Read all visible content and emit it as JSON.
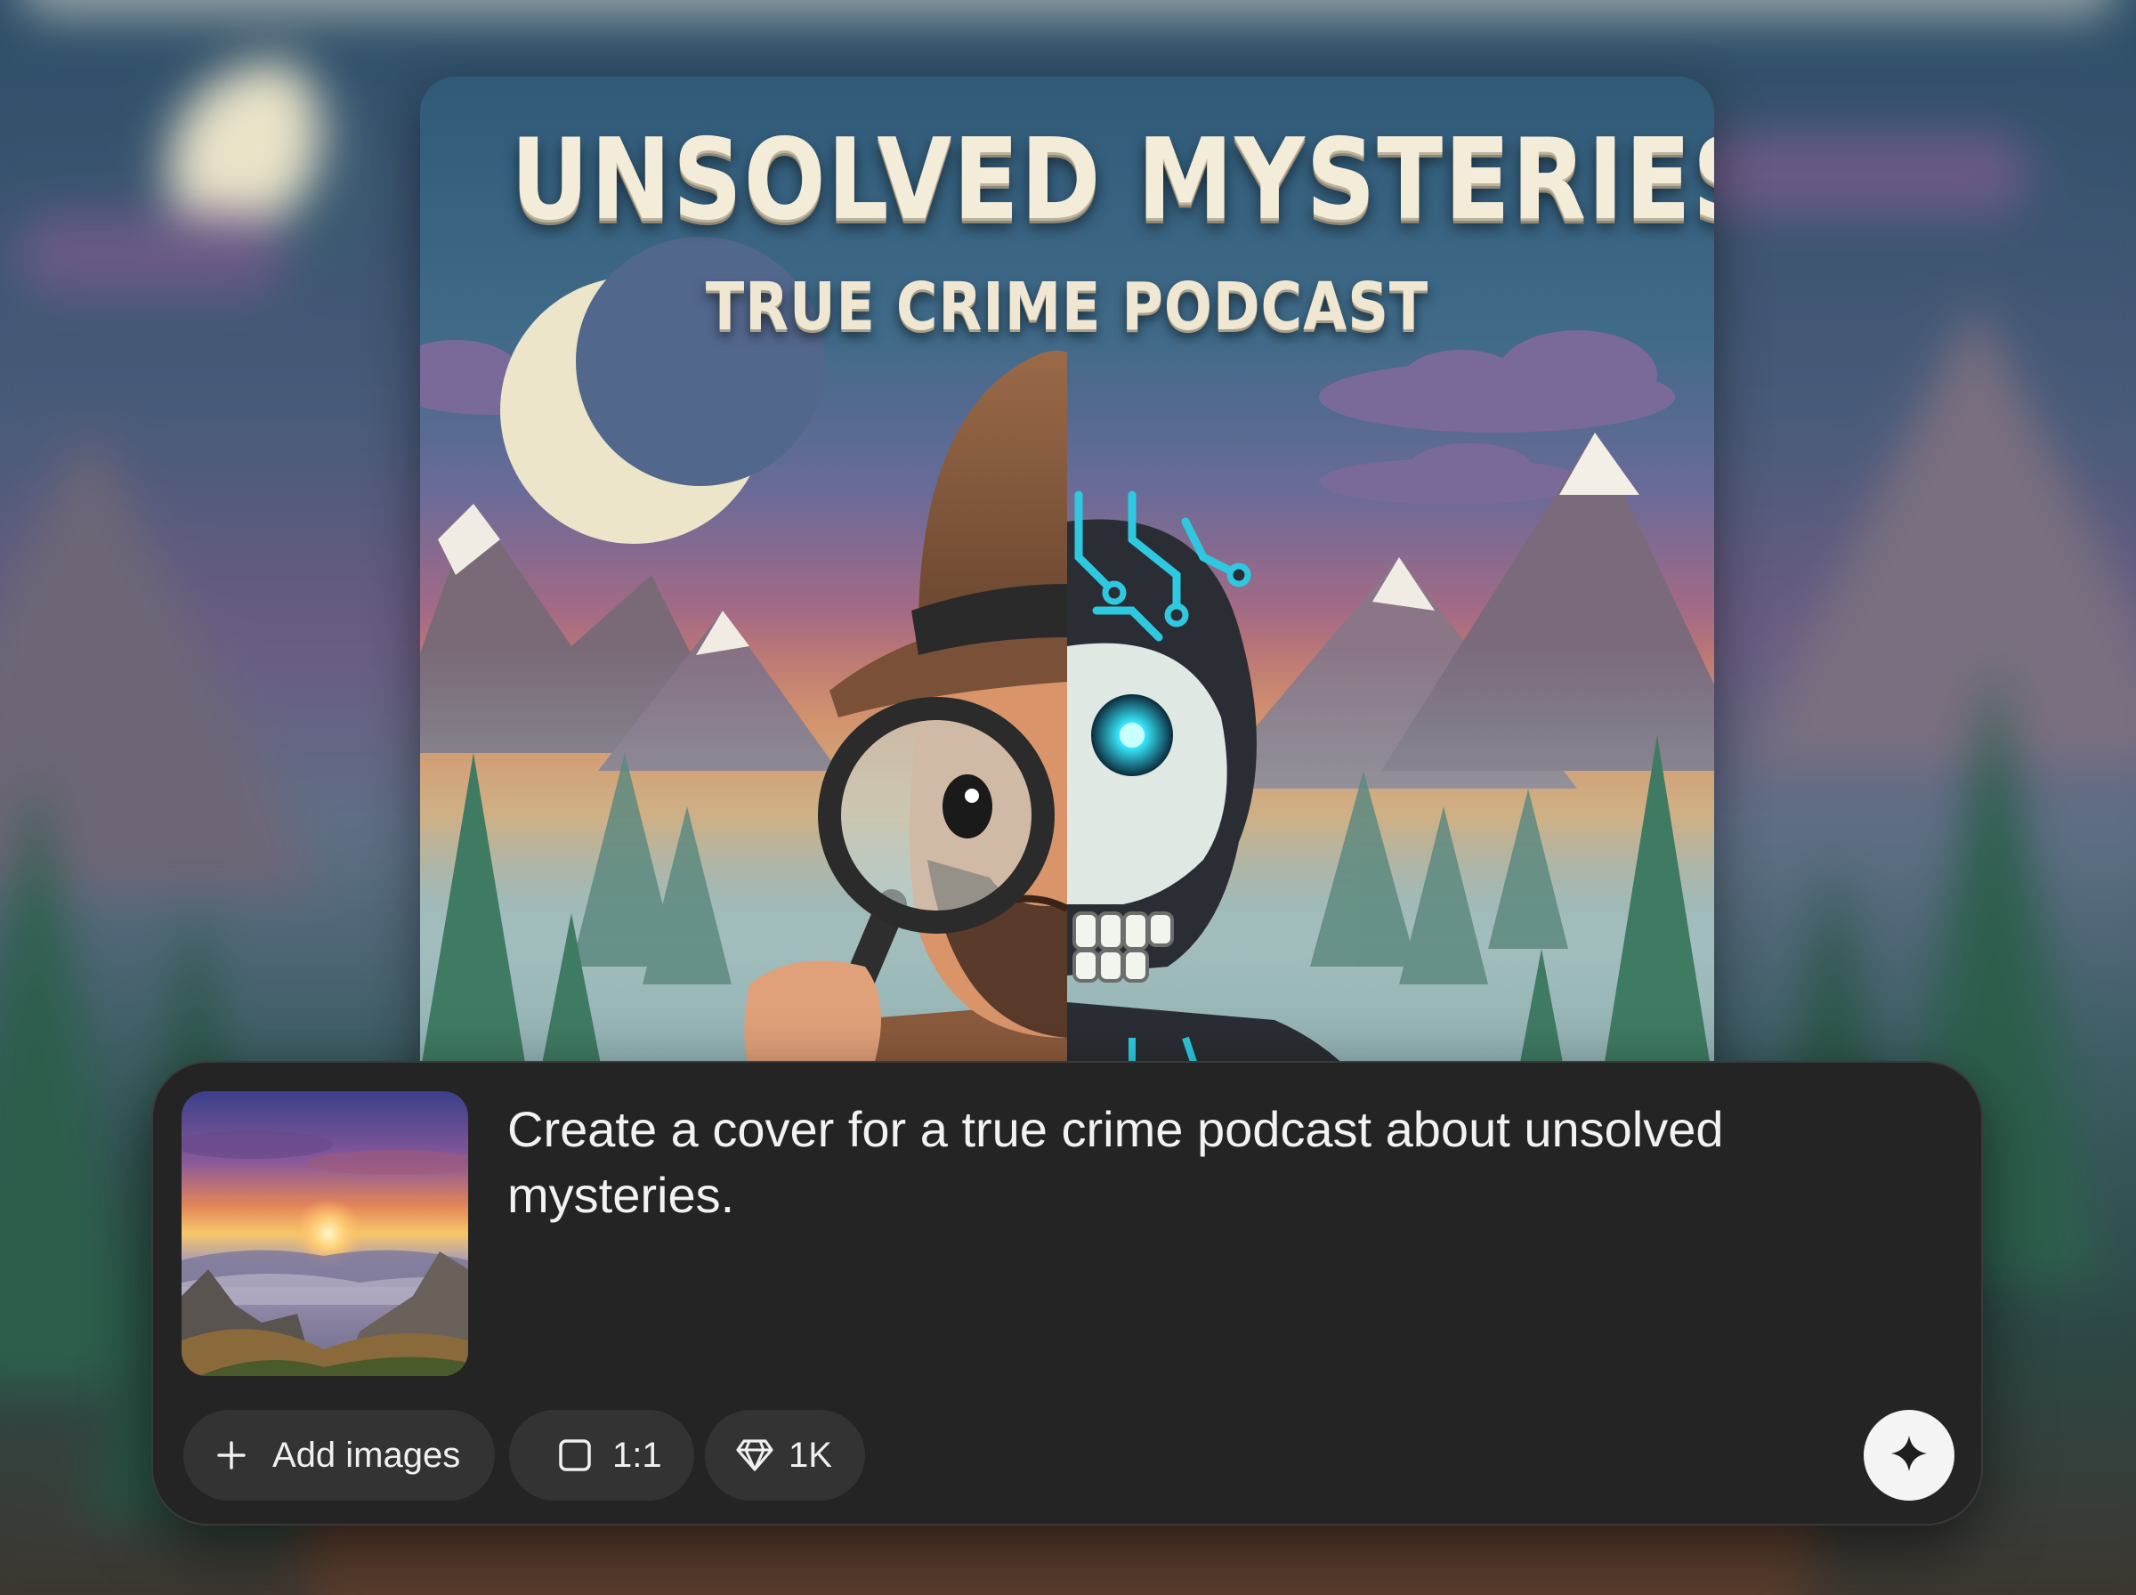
{
  "artwork": {
    "title": "UNSOLVED MYSTERIES",
    "subtitle": "TRUE CRIME PODCAST",
    "image_description_icon": "detective-skeleton-cover-image"
  },
  "prompt": {
    "reference_image_icon": "sunset-mountain-thumbnail",
    "text": "Create a cover for a true crime podcast about unsolved mysteries."
  },
  "toolbar": {
    "add_images_label": "Add images",
    "add_images_icon": "plus-icon",
    "aspect_ratio_label": "1:1",
    "aspect_ratio_icon": "square-icon",
    "quality_label": "1K",
    "quality_icon": "diamond-icon",
    "generate_icon": "sparkle-icon"
  },
  "colors": {
    "panel_bg": "#242424",
    "chip_bg": "#333333",
    "generate_bg": "#f4f4f4",
    "text": "#f2f2f2"
  }
}
